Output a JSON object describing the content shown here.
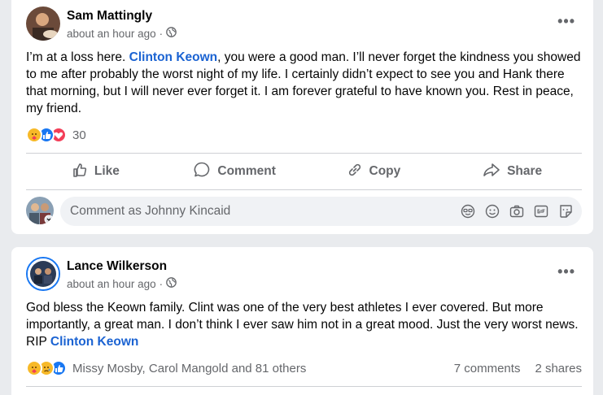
{
  "post1": {
    "author": "Sam Mattingly",
    "time": "about an hour ago",
    "separator": "·",
    "more": "•••",
    "text_before": "I’m at a loss here. ",
    "tag": "Clinton Keown",
    "text_after": ", you were a good man. I’ll never forget the kindness you showed to me after probably the worst night of my life. I certainly didn’t expect to see you and Hank there that morning, but I will never ever forget it. I am forever grateful to have known you. Rest in peace, my friend.",
    "reaction_count": "30",
    "actions": {
      "like": "Like",
      "comment": "Comment",
      "copy": "Copy",
      "share": "Share"
    },
    "comment_placeholder": "Comment as Johnny Kincaid"
  },
  "post2": {
    "author": "Lance Wilkerson",
    "time": "about an hour ago",
    "separator": "·",
    "more": "•••",
    "text_before": "God bless the Keown family. Clint was one of the very best athletes I ever covered.  But more importantly, a great man. I don’t think I ever saw him not in a great mood. Just the very worst news. RIP ",
    "tag": "Clinton Keown",
    "reaction_names": "Missy Mosby, Carol Mangold and 81 others",
    "comments": "7 comments",
    "shares": "2 shares"
  },
  "colors": {
    "accent": "#1b63d2",
    "like_blue": "#1877f2",
    "love_red": "#f33e58",
    "care_yellow": "#f7b928"
  }
}
